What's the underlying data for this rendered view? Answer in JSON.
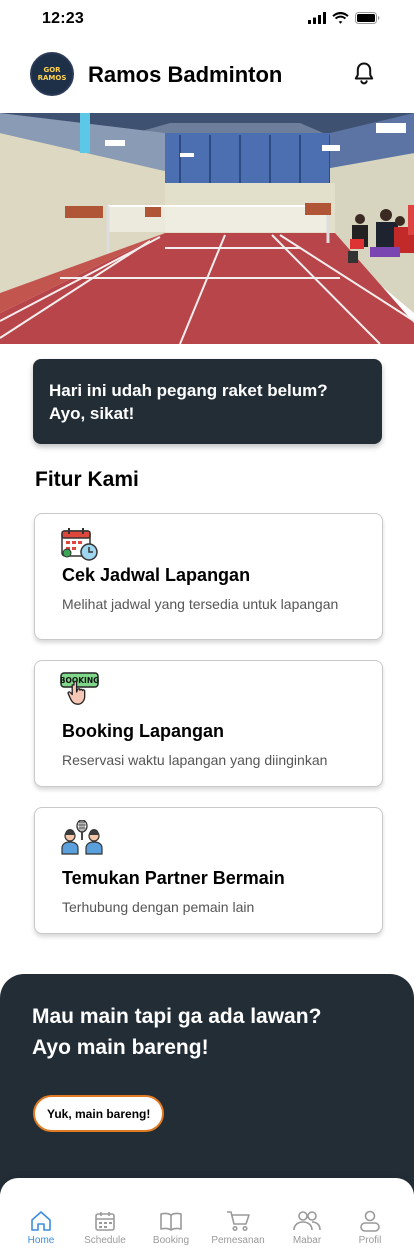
{
  "status_bar": {
    "time": "12:23",
    "icons": [
      "cellular-signal-icon",
      "wifi-icon",
      "battery-icon"
    ]
  },
  "header": {
    "logo_text": "GOR RAMOS",
    "title": "Ramos Badminton",
    "notification_icon": "bell-icon"
  },
  "hero": {
    "image": "badminton-court-photo"
  },
  "greeting": {
    "line1": "Hari ini udah pegang raket belum?",
    "line2": "Ayo, sikat!"
  },
  "features_section": {
    "title": "Fitur Kami",
    "items": [
      {
        "icon": "calendar-clock-icon",
        "title": "Cek Jadwal Lapangan",
        "description": "Melihat jadwal yang tersedia untuk lapangan"
      },
      {
        "icon": "booking-hand-icon",
        "icon_text": "BOOKING",
        "title": "Booking Lapangan",
        "description": "Reservasi waktu lapangan yang diinginkan"
      },
      {
        "icon": "players-racket-icon",
        "title": "Temukan Partner Bermain",
        "description": "Terhubung dengan pemain lain"
      }
    ]
  },
  "mabar": {
    "line1": "Mau main tapi ga ada lawan?",
    "line2": "Ayo main bareng!",
    "button_label": "Yuk, main bareng!"
  },
  "bottom_nav": {
    "items": [
      {
        "label": "Home",
        "icon": "home-icon",
        "active": true
      },
      {
        "label": "Schedule",
        "icon": "calendar-icon",
        "active": false
      },
      {
        "label": "Booking",
        "icon": "book-icon",
        "active": false
      },
      {
        "label": "Pemesanan",
        "icon": "cart-icon",
        "active": false
      },
      {
        "label": "Mabar",
        "icon": "users-icon",
        "active": false
      },
      {
        "label": "Profil",
        "icon": "person-icon",
        "active": false
      }
    ]
  },
  "colors": {
    "dark_panel": "#222d36",
    "accent_orange": "#e07b22",
    "nav_active": "#3b8ede",
    "nav_inactive": "#9a9a9a"
  }
}
